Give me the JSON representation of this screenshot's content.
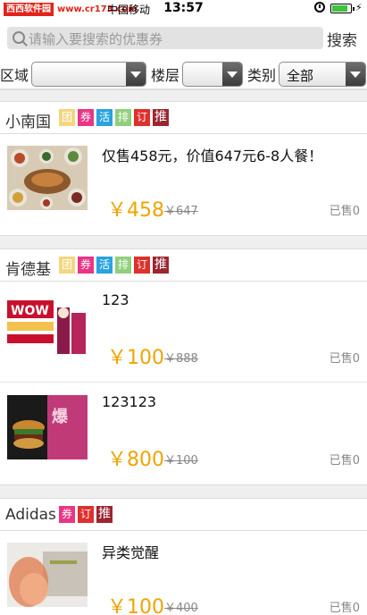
{
  "status_bar": {
    "watermark_cn": "西西软件园",
    "watermark_url": "www.cr173.com",
    "carrier": "中国移动",
    "time": "13:57",
    "battery_level": 0.85
  },
  "search": {
    "placeholder": "请输入要搜索的优惠券",
    "button": "搜索"
  },
  "filters": {
    "area_label": "区域",
    "area_value": "",
    "floor_label": "楼层",
    "floor_value": "",
    "category_label": "类别",
    "category_value": "全部"
  },
  "badge_labels": {
    "tuan": "团",
    "quan": "券",
    "huo": "活",
    "pai": "排",
    "ding": "订",
    "tui": "推"
  },
  "groups": [
    {
      "name": "小南国",
      "items": [
        {
          "title": "仅售458元，价值647元6-8人餐！",
          "price": "￥458",
          "old_price": "￥647",
          "sold": "已售0"
        }
      ]
    },
    {
      "name": "肯德基",
      "items": [
        {
          "title": "123",
          "price": "￥100",
          "old_price": "￥888",
          "sold": "已售0"
        },
        {
          "title": "123123",
          "price": "￥800",
          "old_price": "￥100",
          "sold": "已售0"
        }
      ]
    },
    {
      "name": "Adidas",
      "items": [
        {
          "title": "异类觉醒",
          "price": "￥100",
          "old_price": "￥400",
          "sold": "已售0"
        }
      ]
    }
  ],
  "thumb_text": {
    "kfc_wow": "WOW",
    "burger_text": "爆"
  }
}
